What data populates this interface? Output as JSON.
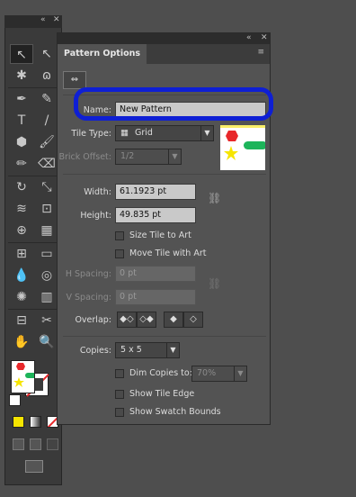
{
  "toolbar": {
    "top_buttons": [
      "«",
      "✕"
    ],
    "tools": [
      "selection-icon",
      "direct-selection-icon",
      "magic-wand-icon",
      "lasso-icon",
      "pen-icon",
      "curvature-icon",
      "type-icon",
      "line-icon",
      "shape-icon",
      "paintbrush-icon",
      "pencil-icon",
      "eraser-icon",
      "rotate-icon",
      "scale-icon",
      "warp-icon",
      "free-transform-icon",
      "shape-builder-icon",
      "perspective-icon",
      "mesh-icon",
      "gradient-icon",
      "eyedropper-icon",
      "blend-icon",
      "symbol-sprayer-icon",
      "graph-icon",
      "artboard-icon",
      "slice-icon",
      "hand-icon",
      "zoom-icon"
    ]
  },
  "panel": {
    "title": "Pattern Options",
    "top_controls": [
      "«",
      "✕"
    ],
    "menu_icon": "≡",
    "name_label": "Name:",
    "name_value": "New Pattern",
    "tile_type_label": "Tile Type:",
    "tile_type_value": "Grid",
    "brick_offset_label": "Brick Offset:",
    "brick_offset_value": "1/2",
    "width_label": "Width:",
    "width_value": "61.1923 pt",
    "height_label": "Height:",
    "height_value": "49.835 pt",
    "size_tile_to_art": "Size Tile to Art",
    "move_tile_with_art": "Move Tile with Art",
    "h_spacing_label": "H Spacing:",
    "h_spacing_value": "0 pt",
    "v_spacing_label": "V Spacing:",
    "v_spacing_value": "0 pt",
    "overlap_label": "Overlap:",
    "copies_label": "Copies:",
    "copies_value": "5 x 5",
    "dim_copies_label": "Dim Copies to:",
    "dim_copies_value": "70%",
    "show_tile_edge": "Show Tile Edge",
    "show_swatch_bounds": "Show Swatch Bounds"
  },
  "colors": {
    "annotation": "#0e1fd4",
    "red": "#e8282b",
    "yellow": "#f6e500",
    "green": "#1db45a"
  }
}
